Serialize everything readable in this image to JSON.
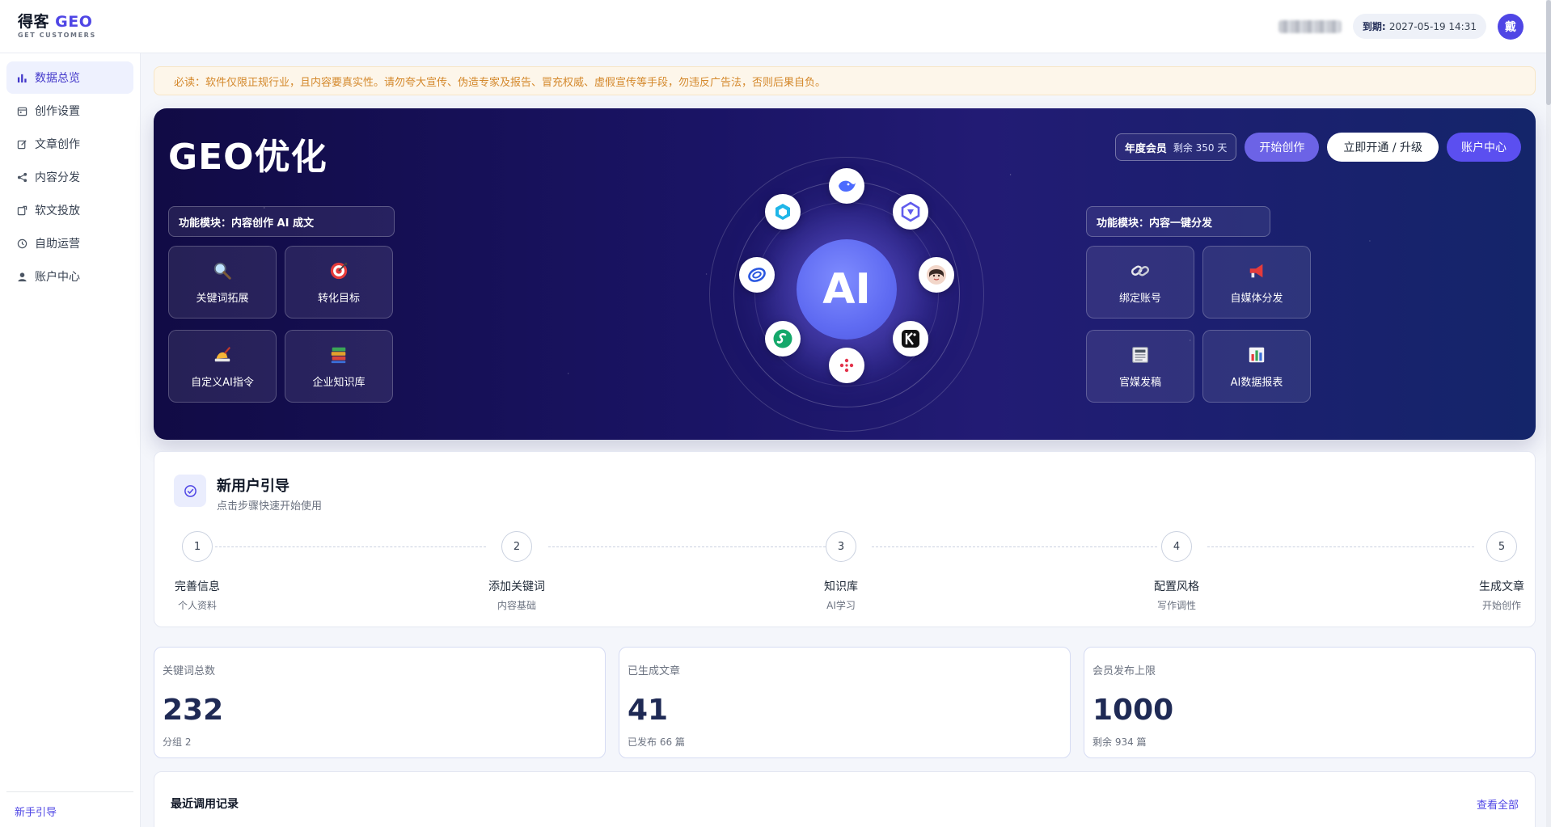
{
  "brand": {
    "name_cn": "得客",
    "name_geo": "GEO",
    "sub": "GET CUSTOMERS",
    "accent": "#4f46e5"
  },
  "header": {
    "expire_label": "到期:",
    "expire_value": "2027-05-19 14:31",
    "avatar_letter": "戴"
  },
  "sidebar": {
    "items": [
      {
        "label": "数据总览",
        "icon": "bar-chart-icon",
        "active": true
      },
      {
        "label": "创作设置",
        "icon": "calendar-icon"
      },
      {
        "label": "文章创作",
        "icon": "edit-icon"
      },
      {
        "label": "内容分发",
        "icon": "share-icon"
      },
      {
        "label": "软文投放",
        "icon": "external-link-icon"
      },
      {
        "label": "自助运营",
        "icon": "clock-icon"
      },
      {
        "label": "账户中心",
        "icon": "user-icon"
      }
    ],
    "footer_link": "新手引导"
  },
  "notice": {
    "text": "必读：软件仅限正规行业，且内容要真实性。请勿夸大宣传、伪造专家及报告、冒充权威、虚假宣传等手段，勿违反广告法，否则后果自负。"
  },
  "hero": {
    "title": "GEO优化",
    "member_label": "年度会员",
    "member_remaining": "剩余 350 天",
    "start_button": "开始创作",
    "upgrade_button": "立即开通 / 升级",
    "account_button": "账户中心",
    "left_module_title": "功能模块：内容创作 AI 成文",
    "left_tiles": [
      {
        "label": "关键词拓展",
        "icon": "magnifier-icon"
      },
      {
        "label": "转化目标",
        "icon": "target-icon"
      },
      {
        "label": "自定义AI指令",
        "icon": "writing-hand-icon"
      },
      {
        "label": "企业知识库",
        "icon": "books-icon"
      }
    ],
    "right_module_title": "功能模块：内容一键分发",
    "right_tiles": [
      {
        "label": "绑定账号",
        "icon": "link-icon"
      },
      {
        "label": "自媒体分发",
        "icon": "megaphone-icon"
      },
      {
        "label": "官媒发稿",
        "icon": "newspaper-icon"
      },
      {
        "label": "AI数据报表",
        "icon": "bar-chart-icon"
      }
    ],
    "ai_core": "AI"
  },
  "guide": {
    "title": "新用户引导",
    "subtitle": "点击步骤快速开始使用",
    "steps": [
      {
        "num": "1",
        "label": "完善信息",
        "sub": "个人资料"
      },
      {
        "num": "2",
        "label": "添加关键词",
        "sub": "内容基础"
      },
      {
        "num": "3",
        "label": "知识库",
        "sub": "AI学习"
      },
      {
        "num": "4",
        "label": "配置风格",
        "sub": "写作调性"
      },
      {
        "num": "5",
        "label": "生成文章",
        "sub": "开始创作"
      }
    ]
  },
  "stats": [
    {
      "label": "关键词总数",
      "value": "232",
      "sub": "分组 2"
    },
    {
      "label": "已生成文章",
      "value": "41",
      "sub": "已发布 66 篇"
    },
    {
      "label": "会员发布上限",
      "value": "1000",
      "sub": "剩余 934 篇"
    }
  ],
  "recent": {
    "title": "最近调用记录",
    "view_all": "查看全部"
  }
}
